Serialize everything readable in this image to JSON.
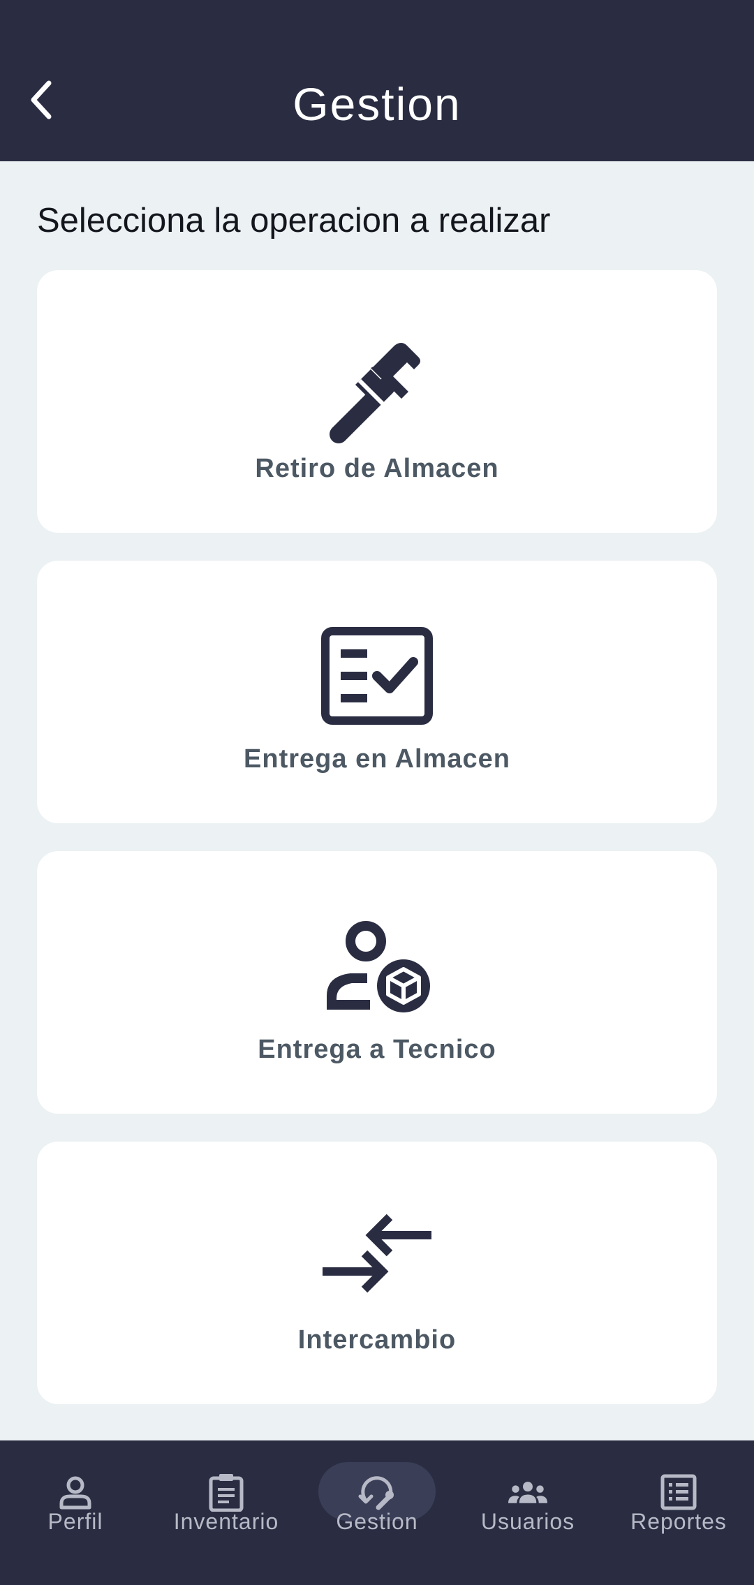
{
  "header": {
    "title": "Gestion"
  },
  "prompt": "Selecciona la operacion a realizar",
  "cards": [
    {
      "label": "Retiro de Almacen",
      "icon": "pipe-wrench-icon"
    },
    {
      "label": "Entrega en Almacen",
      "icon": "checklist-icon"
    },
    {
      "label": "Entrega a Tecnico",
      "icon": "user-package-icon"
    },
    {
      "label": "Intercambio",
      "icon": "exchange-arrows-icon"
    }
  ],
  "nav": [
    {
      "label": "Perfil",
      "icon": "person-icon",
      "active": false
    },
    {
      "label": "Inventario",
      "icon": "clipboard-icon",
      "active": false
    },
    {
      "label": "Gestion",
      "icon": "refresh-wrench-icon",
      "active": true
    },
    {
      "label": "Usuarios",
      "icon": "group-icon",
      "active": false
    },
    {
      "label": "Reportes",
      "icon": "list-report-icon",
      "active": false
    }
  ],
  "colors": {
    "header_bg": "#2A2D42",
    "page_bg": "#ECF1F3",
    "card_bg": "#FFFFFF",
    "icon": "#2A2D42",
    "label": "#4C5863",
    "nav_label": "#B7BAC6",
    "nav_active_pill": "#3A3E57"
  }
}
